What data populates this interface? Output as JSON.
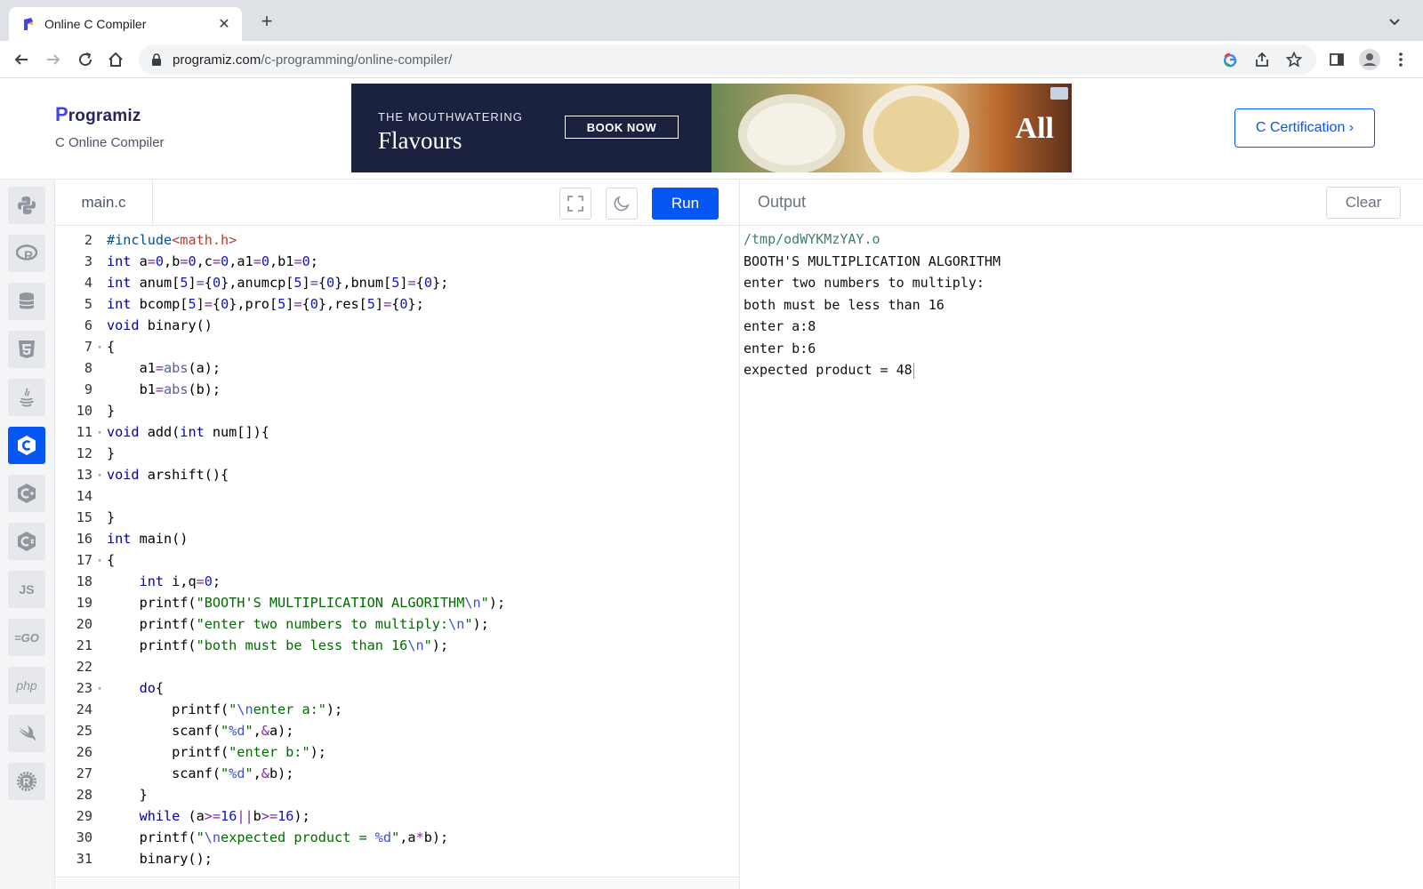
{
  "browser": {
    "tab_title": "Online C Compiler",
    "url_host": "programiz.com",
    "url_path": "/c-programming/online-compiler/"
  },
  "header": {
    "logo_text": "rogramiz",
    "logo_initial": "P",
    "subtitle": "C Online Compiler",
    "ad": {
      "small_text": "THE MOUTHWATERING",
      "big_text": "Flavours",
      "button": "BOOK NOW",
      "brand": "All"
    },
    "cert_button": "C Certification ›"
  },
  "sidebar": {
    "languages": [
      {
        "name": "Python",
        "icon": "python-icon"
      },
      {
        "name": "R",
        "icon": "r-icon"
      },
      {
        "name": "SQL",
        "icon": "database-icon"
      },
      {
        "name": "HTML",
        "icon": "html5-icon"
      },
      {
        "name": "Java",
        "icon": "java-icon"
      },
      {
        "name": "C",
        "icon": "c-icon",
        "active": true
      },
      {
        "name": "C++",
        "icon": "cpp-icon"
      },
      {
        "name": "C#",
        "icon": "csharp-icon"
      },
      {
        "name": "JS",
        "icon": "javascript-icon"
      },
      {
        "name": "GO",
        "icon": "go-icon"
      },
      {
        "name": "php",
        "icon": "php-icon"
      },
      {
        "name": "Swift",
        "icon": "swift-icon"
      },
      {
        "name": "Rust",
        "icon": "rust-icon"
      }
    ]
  },
  "editor": {
    "file_name": "main.c",
    "run_label": "Run",
    "lines": [
      {
        "n": "2",
        "fold": false,
        "text": "#include<math.h>"
      },
      {
        "n": "3",
        "fold": false,
        "text": "int a=0,b=0,c=0,a1=0,b1=0;"
      },
      {
        "n": "4",
        "fold": false,
        "text": "int anum[5]={0},anumcp[5]={0},bnum[5]={0};"
      },
      {
        "n": "5",
        "fold": false,
        "text": "int bcomp[5]={0},pro[5]={0},res[5]={0};"
      },
      {
        "n": "6",
        "fold": false,
        "text": "void binary()"
      },
      {
        "n": "7",
        "fold": true,
        "text": "{"
      },
      {
        "n": "8",
        "fold": false,
        "text": "    a1=abs(a);"
      },
      {
        "n": "9",
        "fold": false,
        "text": "    b1=abs(b);"
      },
      {
        "n": "10",
        "fold": false,
        "text": "}"
      },
      {
        "n": "11",
        "fold": true,
        "text": "void add(int num[]){"
      },
      {
        "n": "12",
        "fold": false,
        "text": "}"
      },
      {
        "n": "13",
        "fold": true,
        "text": "void arshift(){"
      },
      {
        "n": "14",
        "fold": false,
        "text": ""
      },
      {
        "n": "15",
        "fold": false,
        "text": "}"
      },
      {
        "n": "16",
        "fold": false,
        "text": "int main()"
      },
      {
        "n": "17",
        "fold": true,
        "text": "{"
      },
      {
        "n": "18",
        "fold": false,
        "text": "    int i,q=0;"
      },
      {
        "n": "19",
        "fold": false,
        "text": "    printf(\"BOOTH'S MULTIPLICATION ALGORITHM\\n\");"
      },
      {
        "n": "20",
        "fold": false,
        "text": "    printf(\"enter two numbers to multiply:\\n\");"
      },
      {
        "n": "21",
        "fold": false,
        "text": "    printf(\"both must be less than 16\\n\");"
      },
      {
        "n": "22",
        "fold": false,
        "text": ""
      },
      {
        "n": "23",
        "fold": true,
        "text": "    do{"
      },
      {
        "n": "24",
        "fold": false,
        "text": "        printf(\"\\nenter a:\");"
      },
      {
        "n": "25",
        "fold": false,
        "text": "        scanf(\"%d\",&a);"
      },
      {
        "n": "26",
        "fold": false,
        "text": "        printf(\"enter b:\");"
      },
      {
        "n": "27",
        "fold": false,
        "text": "        scanf(\"%d\",&b);"
      },
      {
        "n": "28",
        "fold": false,
        "text": "    }"
      },
      {
        "n": "29",
        "fold": false,
        "text": "    while (a>=16||b>=16);"
      },
      {
        "n": "30",
        "fold": false,
        "text": "    printf(\"\\nexpected product = %d\",a*b);"
      },
      {
        "n": "31",
        "fold": false,
        "text": "    binary();"
      }
    ]
  },
  "output": {
    "title": "Output",
    "clear_label": "Clear",
    "path": "/tmp/odWYKMzYAY.o",
    "lines": [
      "BOOTH'S MULTIPLICATION ALGORITHM",
      "enter two numbers to multiply:",
      "both must be less than 16",
      "enter a:8",
      "enter b:6",
      "expected product = 48"
    ]
  },
  "colors": {
    "accent": "#0556f3",
    "logo_navy": "#25265e"
  }
}
